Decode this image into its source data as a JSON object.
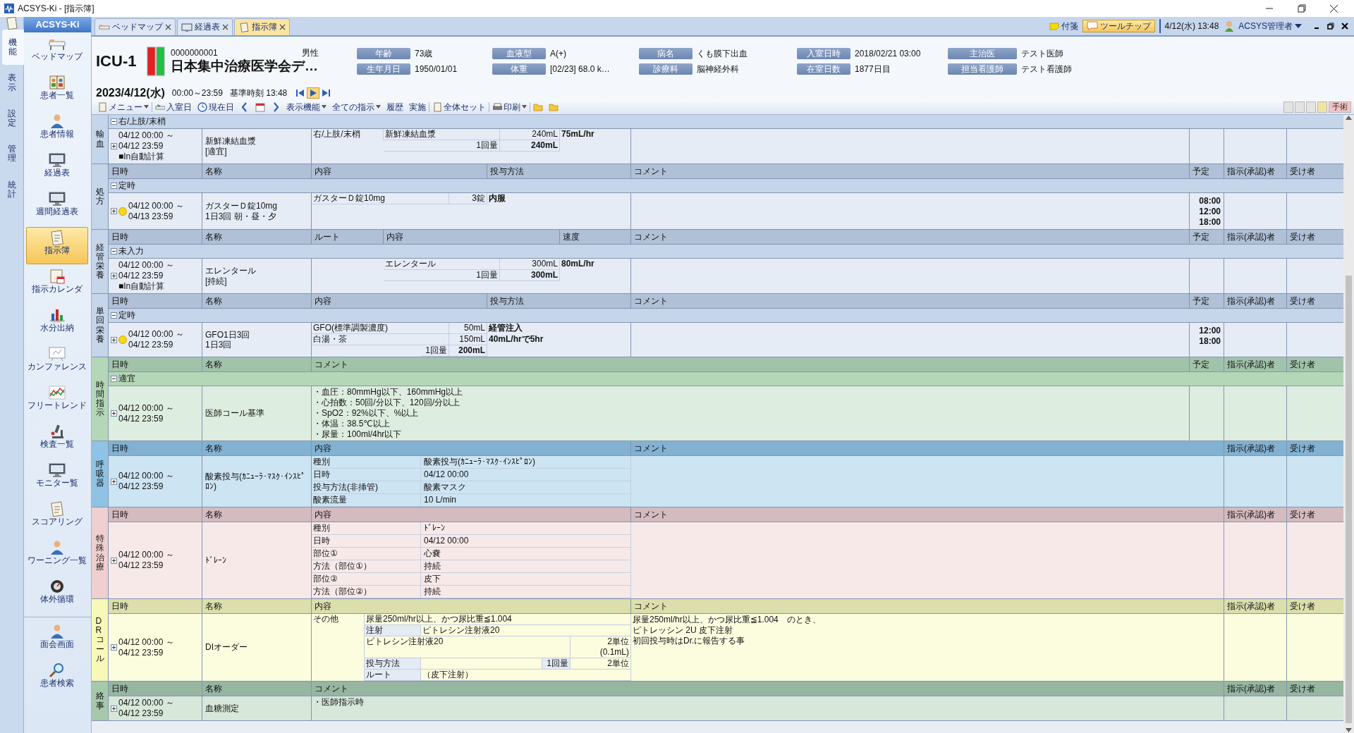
{
  "window": {
    "title": "ACSYS-Ki - [指示簿]"
  },
  "side_tabs": [
    {
      "label": "機能",
      "selected": true
    },
    {
      "label": "表示",
      "selected": false
    },
    {
      "label": "設定",
      "selected": false
    },
    {
      "label": "管理",
      "selected": false
    },
    {
      "label": "統計",
      "selected": false
    }
  ],
  "sidebar": {
    "title": "ACSYS-Ki",
    "items": [
      {
        "label": "ベッドマップ",
        "selected": false
      },
      {
        "label": "患者一覧",
        "selected": false
      },
      {
        "label": "患者情報",
        "selected": false
      },
      {
        "label": "経過表",
        "selected": false
      },
      {
        "label": "週間経過表",
        "selected": false
      },
      {
        "label": "指示簿",
        "selected": true
      },
      {
        "label": "指示カレンダ",
        "selected": false
      },
      {
        "label": "水分出納",
        "selected": false
      },
      {
        "label": "カンファレンス",
        "selected": false
      },
      {
        "label": "フリートレンド",
        "selected": false
      },
      {
        "label": "検査一覧",
        "selected": false
      },
      {
        "label": "モニター覧",
        "selected": false
      },
      {
        "label": "スコアリング",
        "selected": false
      },
      {
        "label": "ワーニング一覧",
        "selected": false
      },
      {
        "label": "体外循環",
        "selected": false
      }
    ],
    "footer_items": [
      {
        "label": "面会画面",
        "selected": false
      },
      {
        "label": "患者検索",
        "selected": false
      }
    ]
  },
  "doc_tabs": [
    {
      "label": "ベッドマップ",
      "selected": false
    },
    {
      "label": "経過表",
      "selected": false
    },
    {
      "label": "指示簿",
      "selected": true
    }
  ],
  "top_right": {
    "sticky_note": "付箋",
    "tooltip": {
      "label": "ツールチップ",
      "on": true
    },
    "datetime": "4/12(水)  13:48",
    "user": "ACSYS管理者"
  },
  "patient": {
    "bed": "ICU-1",
    "id": "0000000001",
    "sex": "男性",
    "name": "日本集中治療医学会デ…",
    "fields": [
      {
        "label": "年齢",
        "value": "73歳"
      },
      {
        "label": "血液型",
        "value": "A(+)"
      },
      {
        "label": "病名",
        "value": "くも膜下出血"
      },
      {
        "label": "入室日時",
        "value": "2018/02/21 03:00"
      },
      {
        "label": "主治医",
        "value": "テスト医師"
      },
      {
        "label": "生年月日",
        "value": "1950/01/01"
      },
      {
        "label": "体重",
        "value": "[02/23] 68.0 k…"
      },
      {
        "label": "診療科",
        "value": "脳神経外科"
      },
      {
        "label": "在室日数",
        "value": "1877日目"
      },
      {
        "label": "担当看護師",
        "value": "テスト看護師"
      }
    ]
  },
  "date_bar": {
    "date": "2023/4/12(水)",
    "range": "00:00～23:59",
    "base_time": "基準時刻 13:48",
    "nav_buttons": [
      {
        "kind": "first",
        "selected": false
      },
      {
        "kind": "play",
        "selected": true
      },
      {
        "kind": "last",
        "selected": false
      }
    ]
  },
  "toolbar": [
    {
      "kind": "menu",
      "label": "メニュー"
    },
    {
      "kind": "admit",
      "label": "入室日"
    },
    {
      "kind": "today",
      "label": "現在日"
    },
    {
      "kind": "prev"
    },
    {
      "kind": "calendar"
    },
    {
      "kind": "next"
    },
    {
      "kind": "display",
      "label": "表示機能"
    },
    {
      "kind": "all",
      "label": "全ての指示"
    },
    {
      "kind": "history",
      "label": "履歴"
    },
    {
      "kind": "execute",
      "label": "実施"
    },
    {
      "kind": "set",
      "label": "全体セット"
    },
    {
      "kind": "print",
      "label": "印刷"
    },
    {
      "kind": "open"
    },
    {
      "kind": "folder"
    }
  ],
  "filter_buttons": [
    {
      "color": "#e4e4e4"
    },
    {
      "color": "#e4e4e4"
    },
    {
      "color": "#e4e4e4"
    },
    {
      "color": "#f1e3a6"
    },
    {
      "label": "手術",
      "color": "#f4c4c4"
    }
  ],
  "sections": [
    {
      "label": "輸血",
      "color": "#c5d5ea",
      "group": {
        "label": "右/上肢/末梢",
        "expanded": true
      },
      "rows": [
        {
          "expanded": false,
          "scheduled": false,
          "start": "04/12 00:00 ～",
          "end": "04/12 23:59",
          "auto_calc": "■In自動計算",
          "name": [
            "新鮮凍結血漿",
            "[適宜]"
          ],
          "content": {
            "lines": [
              [
                {
                  "kind": "route",
                  "text": "右/上肢/末梢"
                },
                {
                  "kind": "item",
                  "text": "新鮮凍結血漿"
                },
                {
                  "kind": "qty",
                  "text": "240mL"
                },
                {
                  "kind": "rate",
                  "text": "75mL/hr"
                }
              ],
              [
                {
                  "kind": "dose-wide",
                  "text": "1回量"
                },
                {
                  "kind": "total",
                  "text": "240mL"
                }
              ]
            ]
          }
        }
      ]
    },
    {
      "label": "処方",
      "color": "#c5d5ea",
      "header": [
        {
          "kind": "date",
          "label": "日時"
        },
        {
          "kind": "name",
          "label": "名称"
        },
        {
          "kind": "content",
          "label": "内容"
        },
        {
          "kind": "method",
          "label": "投与方法"
        },
        {
          "kind": "comment",
          "label": "コメント"
        },
        {
          "kind": "schedule",
          "label": "予定"
        },
        {
          "kind": "approver",
          "label": "指示(承認)者"
        },
        {
          "kind": "receiver",
          "label": "受け者"
        }
      ],
      "group": {
        "label": "定時",
        "expanded": true
      },
      "rows": [
        {
          "expanded": false,
          "scheduled": true,
          "start": "04/12 00:00 ～",
          "end": "04/13 23:59",
          "name": [
            "ガスターＤ錠10mg",
            "1日3回 朝・昼・夕"
          ],
          "content": {
            "lines": [
              [
                {
                  "kind": "drug",
                  "text": "ガスターＤ錠10mg"
                },
                {
                  "kind": "dqty",
                  "text": "3錠"
                },
                {
                  "kind": "method",
                  "text": "内服"
                }
              ]
            ]
          },
          "schedule": [
            "08:00",
            "12:00",
            "18:00"
          ]
        }
      ]
    },
    {
      "label": "経管栄養",
      "color": "#c5d5ea",
      "header": [
        {
          "kind": "date",
          "label": "日時"
        },
        {
          "kind": "name",
          "label": "名称"
        },
        {
          "kind": "route",
          "label": "ルート"
        },
        {
          "kind": "item",
          "label": "内容"
        },
        {
          "kind": "speed",
          "label": "速度"
        },
        {
          "kind": "comment",
          "label": "コメント"
        },
        {
          "kind": "schedule",
          "label": "予定"
        },
        {
          "kind": "approver",
          "label": "指示(承認)者"
        },
        {
          "kind": "receiver",
          "label": "受け者"
        }
      ],
      "group": {
        "label": "未入力",
        "expanded": true
      },
      "rows": [
        {
          "expanded": false,
          "scheduled": false,
          "start": "04/12 00:00 ～",
          "end": "04/12 23:59",
          "auto_calc": "■In自動計算",
          "name": [
            "エレンタール",
            "[持続]"
          ],
          "content": {
            "lines": [
              [
                {
                  "kind": "item",
                  "text": "エレンタール"
                },
                {
                  "kind": "qty",
                  "text": "300mL"
                },
                {
                  "kind": "rate",
                  "text": "80mL/hr"
                }
              ],
              [
                {
                  "kind": "dose-wide",
                  "text": "1回量"
                },
                {
                  "kind": "total",
                  "text": "300mL"
                }
              ]
            ]
          }
        }
      ]
    },
    {
      "label": "単回栄養",
      "color": "#c5d5ea",
      "header": [
        {
          "kind": "date",
          "label": "日時"
        },
        {
          "kind": "name",
          "label": "名称"
        },
        {
          "kind": "content",
          "label": "内容"
        },
        {
          "kind": "method",
          "label": "投与方法"
        },
        {
          "kind": "comment",
          "label": "コメント"
        },
        {
          "kind": "schedule",
          "label": "予定"
        },
        {
          "kind": "approver",
          "label": "指示(承認)者"
        },
        {
          "kind": "receiver",
          "label": "受け者"
        }
      ],
      "group": {
        "label": "定時",
        "expanded": true
      },
      "rows": [
        {
          "expanded": false,
          "scheduled": true,
          "start": "04/12 00:00 ～",
          "end": "04/12 23:59",
          "name": [
            "GFO1日3回",
            "1日3回"
          ],
          "content": {
            "lines": [
              [
                {
                  "kind": "drug",
                  "text": "GFO(標準調製濃度)"
                },
                {
                  "kind": "dqty",
                  "text": "50mL"
                },
                {
                  "kind": "method",
                  "text": "経管注入"
                }
              ],
              [
                {
                  "kind": "drug",
                  "text": "白湯・茶"
                },
                {
                  "kind": "dqty",
                  "text": "150mL"
                },
                {
                  "kind": "method",
                  "text": "40mL/hrで5hr"
                }
              ],
              [
                {
                  "kind": "dose",
                  "text": "1回量"
                },
                {
                  "kind": "dtotal",
                  "text": "200mL"
                }
              ]
            ]
          },
          "schedule": [
            "12:00",
            "18:00"
          ]
        }
      ]
    },
    {
      "label": "時間指示",
      "color": "#b4d8b7",
      "header": [
        {
          "kind": "date",
          "label": "日時"
        },
        {
          "kind": "name",
          "label": "名称"
        },
        {
          "kind": "comment-full",
          "label": "コメント"
        },
        {
          "kind": "schedule",
          "label": "予定"
        },
        {
          "kind": "approver",
          "label": "指示(承認)者"
        },
        {
          "kind": "receiver",
          "label": "受け者"
        }
      ],
      "group": {
        "label": "適宜",
        "expanded": true
      },
      "rows": [
        {
          "expanded": false,
          "scheduled": false,
          "start": "04/12 00:00 ～",
          "end": "04/12 23:59",
          "name": [
            "医師コール基準"
          ],
          "comment": [
            "・血圧：80mmHg以下、160mmHg以上",
            "・心拍数：50回/分以下、120回/分以上",
            "・SpO2：92%以下、%以上",
            "・体温：38.5℃以上",
            "・尿量：100ml/4hr以下"
          ]
        }
      ]
    },
    {
      "label": "呼吸器",
      "color": "#8fc3e5",
      "header": [
        {
          "kind": "date",
          "label": "日時"
        },
        {
          "kind": "name",
          "label": "名称"
        },
        {
          "kind": "content-full",
          "label": "内容"
        },
        {
          "kind": "comment",
          "label": "コメント"
        },
        {
          "kind": "approver",
          "label": "指示(承認)者"
        },
        {
          "kind": "receiver",
          "label": "受け者"
        }
      ],
      "rows": [
        {
          "expanded": false,
          "scheduled": false,
          "start": "04/12 00:00 ～",
          "end": "04/12 23:59",
          "name": [
            "酸素投与(ｶﾆｭｰﾗ･ﾏｽｸ･ｲﾝｽﾋﾟﾛﾝ)"
          ],
          "content": {
            "lines": [
              [
                {
                  "kind": "key",
                  "text": "種別"
                },
                {
                  "kind": "value",
                  "text": "酸素投与(ｶﾆｭｰﾗ･ﾏｽｸ･ｲﾝｽﾋﾟﾛﾝ)"
                }
              ],
              [
                {
                  "kind": "key",
                  "text": "日時"
                },
                {
                  "kind": "value",
                  "text": "04/12 00:00"
                }
              ],
              [
                {
                  "kind": "key",
                  "text": "投与方法(非挿管)"
                },
                {
                  "kind": "value",
                  "text": "酸素マスク"
                }
              ],
              [
                {
                  "kind": "key",
                  "text": "酸素流量"
                },
                {
                  "kind": "value",
                  "text": "10 L/min"
                }
              ]
            ]
          }
        }
      ]
    },
    {
      "label": "特殊治療",
      "color": "#efcfcf",
      "header": [
        {
          "kind": "date",
          "label": "日時"
        },
        {
          "kind": "name",
          "label": "名称"
        },
        {
          "kind": "content-full",
          "label": "内容"
        },
        {
          "kind": "comment",
          "label": "コメント"
        },
        {
          "kind": "approver",
          "label": "指示(承認)者"
        },
        {
          "kind": "receiver",
          "label": "受け者"
        }
      ],
      "rows": [
        {
          "expanded": false,
          "scheduled": false,
          "start": "04/12 00:00 ～",
          "end": "04/12 23:59",
          "name": [
            "ﾄﾞﾚｰﾝ"
          ],
          "content": {
            "lines": [
              [
                {
                  "kind": "key",
                  "text": "種別"
                },
                {
                  "kind": "value",
                  "text": "ﾄﾞﾚｰﾝ"
                }
              ],
              [
                {
                  "kind": "key",
                  "text": "日時"
                },
                {
                  "kind": "value",
                  "text": "04/12 00:00"
                }
              ],
              [
                {
                  "kind": "key",
                  "text": "部位①"
                },
                {
                  "kind": "value",
                  "text": "心嚢"
                }
              ],
              [
                {
                  "kind": "key",
                  "text": "方法（部位①）"
                },
                {
                  "kind": "value",
                  "text": "持続"
                }
              ],
              [
                {
                  "kind": "key",
                  "text": "部位②"
                },
                {
                  "kind": "value",
                  "text": "皮下"
                }
              ],
              [
                {
                  "kind": "key",
                  "text": "方法（部位②）"
                },
                {
                  "kind": "value",
                  "text": "持続"
                }
              ]
            ]
          }
        }
      ]
    },
    {
      "label": "DRコール",
      "color": "#f8f8b8",
      "header": [
        {
          "kind": "date",
          "label": "日時"
        },
        {
          "kind": "name",
          "label": "名称"
        },
        {
          "kind": "content-full",
          "label": "内容"
        },
        {
          "kind": "comment",
          "label": "コメント"
        },
        {
          "kind": "approver",
          "label": "指示(承認)者"
        },
        {
          "kind": "receiver",
          "label": "受け者"
        }
      ],
      "rows": [
        {
          "expanded": false,
          "scheduled": false,
          "start": "04/12 00:00 ～",
          "end": "04/12 23:59",
          "name": [
            "DIオーダー"
          ],
          "content": {
            "side": "その他",
            "lines": [
              [
                {
                  "kind": "dr-text",
                  "text": "尿量250ml/hr以上、かつ尿比重≦1.004"
                }
              ],
              [
                {
                  "kind": "dr-key",
                  "text": "注射"
                },
                {
                  "kind": "dr-value",
                  "text": "ピトレシン注射液20"
                }
              ],
              [
                {
                  "kind": "dr-drug",
                  "text": "ピトレシン注射液20"
                },
                {
                  "kind": "dr-amt",
                  "text": "2単位 (0.1mL)"
                }
              ],
              [
                {
                  "kind": "dr-key",
                  "text": "投与方法"
                },
                {
                  "kind": "dr-gap"
                },
                {
                  "kind": "dr-dlabel",
                  "text": "1回量"
                },
                {
                  "kind": "dr-amt",
                  "text": "2単位"
                }
              ],
              [
                {
                  "kind": "dr-key",
                  "text": "ルート"
                },
                {
                  "kind": "dr-value",
                  "text": "（皮下注射）"
                }
              ]
            ]
          },
          "comment": [
            "尿量250ml/hr以上、かつ尿比重≦1.004　のとき、",
            "ピトレッシン 2U 皮下注射",
            "初回投与時はDr.に報告する事"
          ]
        }
      ]
    },
    {
      "label": "絡事",
      "color": "#a6c9ab",
      "header": [
        {
          "kind": "date",
          "label": "日時"
        },
        {
          "kind": "name",
          "label": "名称"
        },
        {
          "kind": "comment-full",
          "label": "コメント"
        },
        {
          "kind": "approver",
          "label": "指示(承認)者"
        },
        {
          "kind": "receiver",
          "label": "受け者"
        }
      ],
      "rows": [
        {
          "expanded": false,
          "scheduled": false,
          "start": "04/12 00:00 ～",
          "end": "04/12 23:59",
          "name": [
            "血糖測定"
          ],
          "comment": [
            "・医師指示時"
          ]
        }
      ]
    }
  ]
}
